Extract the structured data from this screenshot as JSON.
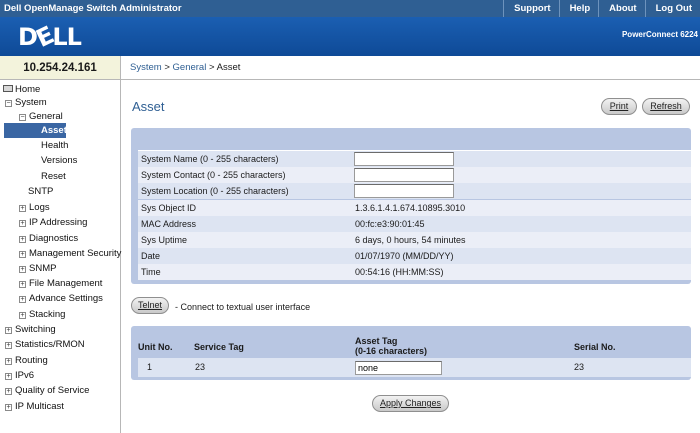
{
  "header": {
    "app_title": "Dell OpenManage Switch Administrator",
    "menu": [
      "Support",
      "Help",
      "About",
      "Log Out"
    ],
    "logo": "DELL",
    "product": "PowerConnect 6224"
  },
  "device_ip": "10.254.24.161",
  "breadcrumb": {
    "system": "System",
    "general": "General",
    "current": "Asset",
    "sep1": " > ",
    "sep2": " > "
  },
  "nav": {
    "home": "Home",
    "system": "System",
    "general": "General",
    "asset": "Asset",
    "health": "Health",
    "versions": "Versions",
    "reset": "Reset",
    "sntp": "SNTP",
    "logs": "Logs",
    "ip_addressing": "IP Addressing",
    "diagnostics": "Diagnostics",
    "management_security": "Management Security",
    "snmp": "SNMP",
    "file_management": "File Management",
    "advance_settings": "Advance Settings",
    "stacking": "Stacking",
    "switching": "Switching",
    "statistics_rmon": "Statistics/RMON",
    "routing": "Routing",
    "ipv6": "IPv6",
    "quality_of_service": "Quality of Service",
    "ip_multicast": "IP Multicast",
    "expand_glyph": "+",
    "collapse_glyph": "−"
  },
  "page": {
    "title": "Asset",
    "print_label": "Print",
    "refresh_label": "Refresh"
  },
  "system_info": {
    "system_name_label": "System Name (0 - 255 characters)",
    "system_name_value": "",
    "system_contact_label": "System Contact (0 - 255 characters)",
    "system_contact_value": "",
    "system_location_label": "System Location (0 - 255 characters)",
    "system_location_value": "",
    "sys_object_id_label": "Sys Object ID",
    "sys_object_id_value": "1.3.6.1.4.1.674.10895.3010",
    "mac_label": "MAC Address",
    "mac_value": "00:fc:e3:90:01:45",
    "uptime_label": "Sys Uptime",
    "uptime_value": "6 days, 0 hours, 54 minutes",
    "date_label": "Date",
    "date_value": "01/07/1970 (MM/DD/YY)",
    "time_label": "Time",
    "time_value": "00:54:16 (HH:MM:SS)"
  },
  "telnet": {
    "button_label": "Telnet",
    "note": "- Connect to textual user interface"
  },
  "asset_table": {
    "col_unit": "Unit No.",
    "col_service": "Service Tag",
    "col_asset_line1": "Asset Tag",
    "col_asset_line2": "(0-16 characters)",
    "col_serial": "Serial No.",
    "row": {
      "unit": "1",
      "service_tag": "23",
      "asset_tag": "none",
      "serial": "23"
    }
  },
  "apply_label": "Apply Changes"
}
